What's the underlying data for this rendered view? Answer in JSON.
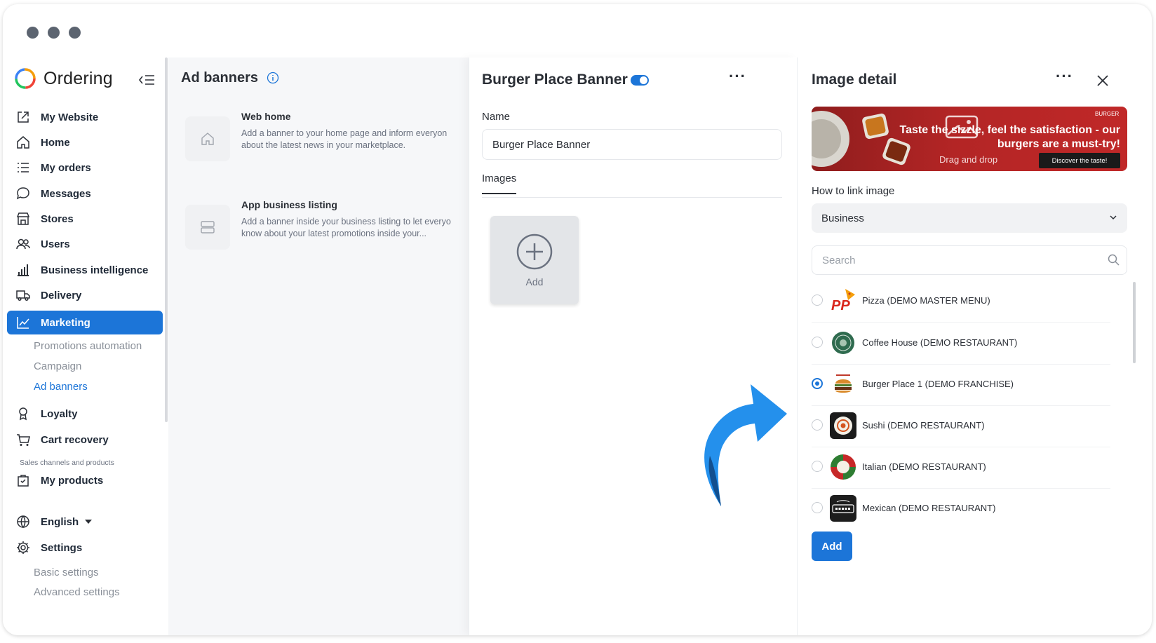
{
  "app": {
    "name": "Ordering"
  },
  "sidebar": {
    "items": [
      {
        "label": "My Website",
        "icon": "external-link-icon"
      },
      {
        "label": "Home",
        "icon": "home-icon"
      },
      {
        "label": "My orders",
        "icon": "list-icon"
      },
      {
        "label": "Messages",
        "icon": "chat-bubble-icon"
      },
      {
        "label": "Stores",
        "icon": "store-icon"
      },
      {
        "label": "Users",
        "icon": "users-icon"
      },
      {
        "label": "Business intelligence",
        "icon": "bar-chart-icon"
      },
      {
        "label": "Delivery",
        "icon": "truck-icon"
      },
      {
        "label": "Marketing",
        "icon": "trend-chart-icon",
        "active": true
      },
      {
        "label": "Loyalty",
        "icon": "award-icon"
      },
      {
        "label": "Cart recovery",
        "icon": "cart-icon"
      },
      {
        "label": "My products",
        "icon": "bag-check-icon"
      },
      {
        "label": "English",
        "icon": "globe-icon"
      },
      {
        "label": "Settings",
        "icon": "gear-icon"
      }
    ],
    "marketing_sub": [
      "Promotions automation",
      "Campaign",
      "Ad banners"
    ],
    "section_label": "Sales channels and products",
    "settings_sub": [
      "Basic settings",
      "Advanced settings"
    ]
  },
  "ad_banners": {
    "title": "Ad banners",
    "cards": [
      {
        "title": "Web home",
        "description_line1": "Add a banner to your home page and inform everyon",
        "description_line2": "about the latest news in your marketplace."
      },
      {
        "title": "App business listing",
        "description_line1": "Add a banner inside your business listing to let everyo",
        "description_line2": "know about your latest promotions inside your..."
      }
    ]
  },
  "editor": {
    "title": "Burger Place Banner",
    "enabled": true,
    "name_label": "Name",
    "name_value": "Burger Place Banner",
    "tab_images": "Images",
    "add_label": "Add"
  },
  "detail": {
    "title": "Image detail",
    "preview": {
      "headline_line1": "Taste the sizzle, feel the satisfaction - our",
      "headline_line2": "burgers are a must-try!",
      "drag_text": "Drag and drop",
      "cta": "Discover the taste!",
      "brand": "BURGER"
    },
    "link_label": "How to link image",
    "link_value": "Business",
    "search_placeholder": "Search",
    "businesses": [
      {
        "name": "Pizza (DEMO MASTER MENU)",
        "selected": false
      },
      {
        "name": "Coffee House (DEMO RESTAURANT)",
        "selected": false
      },
      {
        "name": "Burger Place 1 (DEMO FRANCHISE)",
        "selected": true
      },
      {
        "name": "Sushi (DEMO RESTAURANT)",
        "selected": false
      },
      {
        "name": "Italian (DEMO RESTAURANT)",
        "selected": false
      },
      {
        "name": "Mexican (DEMO RESTAURANT)",
        "selected": false
      }
    ],
    "add_button": "Add"
  },
  "colors": {
    "accent": "#1c75d8",
    "window_dot": "#5c6470"
  }
}
